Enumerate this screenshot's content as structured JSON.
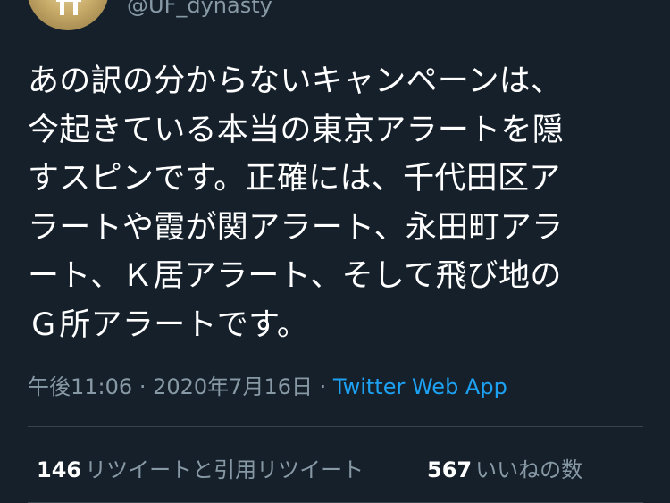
{
  "author": {
    "handle": "@UF_dynasty"
  },
  "tweet": {
    "lines": [
      "あの訳の分からないキャンペーンは、",
      "今起きている本当の東京アラートを隠",
      "すスピンです。正確には、千代田区ア",
      "ラートや霞が関アラート、永田町アラ",
      "ート、Ｋ居アラート、そして飛び地の",
      "Ｇ所アラートです。"
    ]
  },
  "meta": {
    "time": "午後11:06",
    "separator": "·",
    "date": "2020年7月16日",
    "source": "Twitter Web App"
  },
  "stats": {
    "retweets_count": "146",
    "retweets_label": "リツイートと引用リツイート",
    "likes_count": "567",
    "likes_label": "いいねの数"
  },
  "colors": {
    "background": "#15202b",
    "text": "#ffffff",
    "secondary_text": "#8899a6",
    "link": "#1da1f2",
    "divider": "#38444d"
  }
}
